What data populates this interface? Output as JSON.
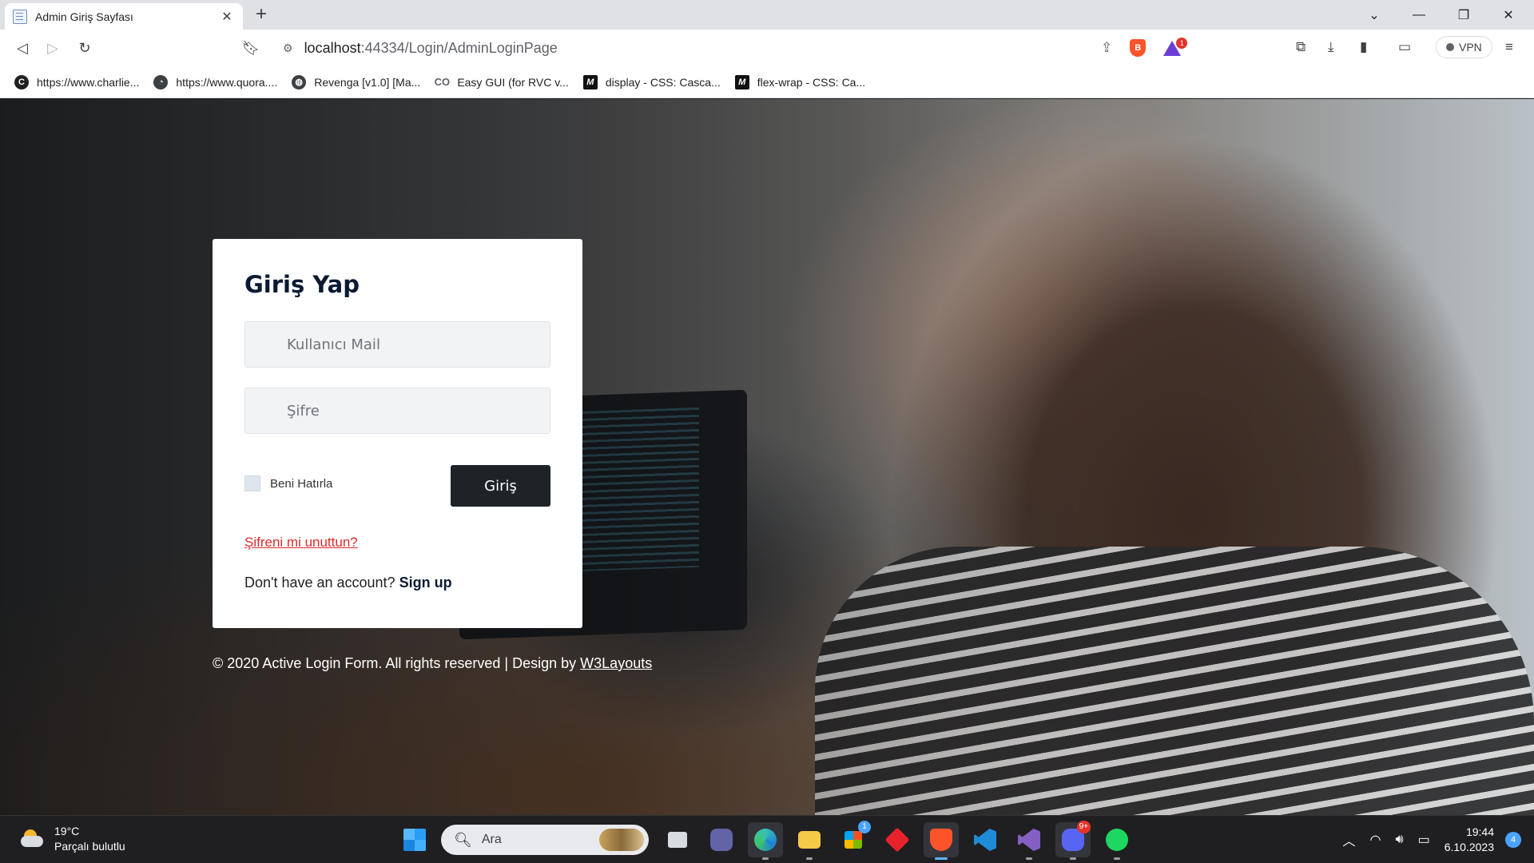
{
  "browser": {
    "tab": {
      "title": "Admin Giriş Sayfası"
    },
    "address": {
      "host": "localhost",
      "path": ":44334/Login/AdminLoginPage"
    },
    "vpn_label": "VPN",
    "brave_badge": "1",
    "bookmarks": [
      {
        "label": "https://www.charlie...",
        "icon": "charlie-icon"
      },
      {
        "label": "https://www.quora....",
        "icon": "quora-icon"
      },
      {
        "label": "Revenga [v1.0] [Ma...",
        "icon": "globe-icon"
      },
      {
        "label": "Easy GUI (for RVC v...",
        "icon": "colab-icon"
      },
      {
        "label": "display - CSS: Casca...",
        "icon": "mdn-icon"
      },
      {
        "label": "flex-wrap - CSS: Ca...",
        "icon": "mdn-icon"
      }
    ]
  },
  "login": {
    "heading": "Giriş Yap",
    "email_placeholder": "Kullanıcı Mail",
    "password_placeholder": "Şifre",
    "remember_label": "Beni Hatırla",
    "submit_label": "Giriş",
    "forgot_label": "Şifreni mi unuttun?",
    "signup_prompt": "Don't have an account?",
    "signup_link": "Sign up"
  },
  "footer": {
    "copyright": "© 2020 Active Login Form. All rights reserved | Design by",
    "designer_link": "W3Layouts"
  },
  "taskbar": {
    "weather_temp": "19°C",
    "weather_desc": "Parçalı bulutlu",
    "search_label": "Ara",
    "store_badge": "1",
    "discord_badge": "9+",
    "time": "19:44",
    "date": "6.10.2023",
    "notification_count": "4"
  },
  "colors": {
    "accent_red": "#e0282c",
    "button_dark": "#1e2328",
    "heading_navy": "#0b1a33"
  }
}
